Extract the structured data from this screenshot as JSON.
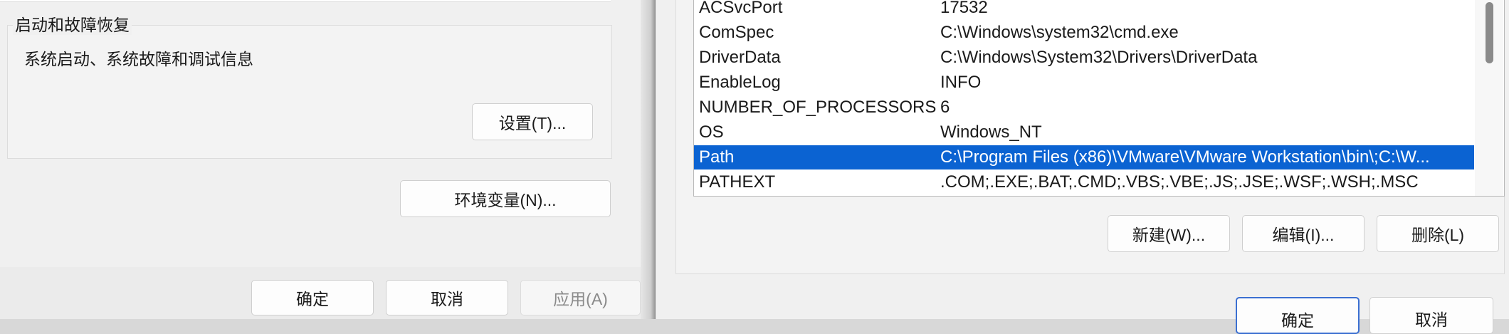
{
  "left_dialog": {
    "startup_group": {
      "title": "启动和故障恢复",
      "description": "系统启动、系统故障和调试信息",
      "settings_button": "设置(T)..."
    },
    "env_vars_button": "环境变量(N)...",
    "footer": {
      "ok": "确定",
      "cancel": "取消",
      "apply": "应用(A)"
    }
  },
  "right_dialog": {
    "variables": [
      {
        "name": "ACSvcPort",
        "value": "17532"
      },
      {
        "name": "ComSpec",
        "value": "C:\\Windows\\system32\\cmd.exe"
      },
      {
        "name": "DriverData",
        "value": "C:\\Windows\\System32\\Drivers\\DriverData"
      },
      {
        "name": "EnableLog",
        "value": "INFO"
      },
      {
        "name": "NUMBER_OF_PROCESSORS",
        "value": "6"
      },
      {
        "name": "OS",
        "value": "Windows_NT"
      },
      {
        "name": "Path",
        "value": "C:\\Program Files (x86)\\VMware\\VMware Workstation\\bin\\;C:\\W..."
      },
      {
        "name": "PATHEXT",
        "value": ".COM;.EXE;.BAT;.CMD;.VBS;.VBE;.JS;.JSE;.WSF;.WSH;.MSC"
      }
    ],
    "selected_variable": "Path",
    "buttons": {
      "new": "新建(W)...",
      "edit": "编辑(I)...",
      "delete": "删除(L)"
    },
    "footer": {
      "ok": "确定",
      "cancel": "取消"
    }
  },
  "colors": {
    "selection": "#0b63d2",
    "primary_border": "#3b6fd1"
  }
}
